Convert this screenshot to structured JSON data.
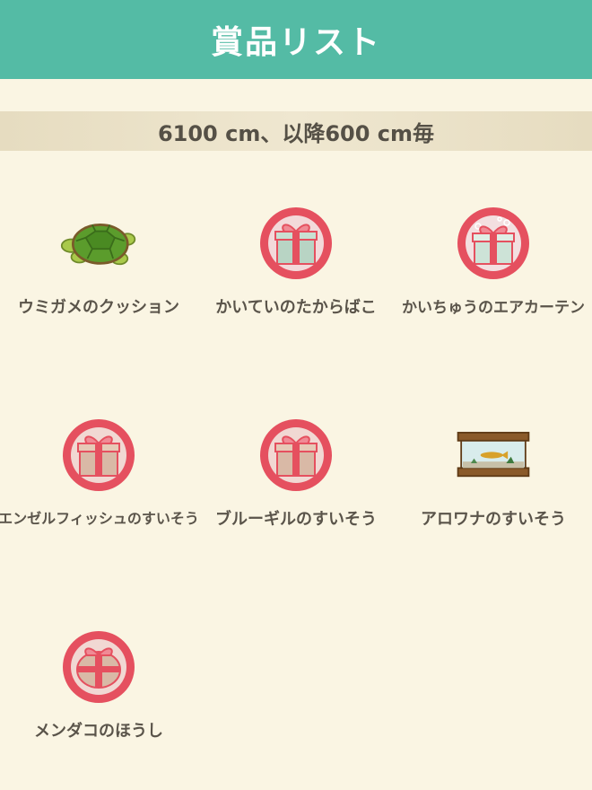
{
  "header": {
    "title": "賞品リスト"
  },
  "band": {
    "text": "6100 cm、以降600 cm毎"
  },
  "prizes": [
    {
      "label": "ウミガメのクッション",
      "icon": "turtle-cushion-icon"
    },
    {
      "label": "かいていのたからばこ",
      "icon": "gift-icon"
    },
    {
      "label": "かいちゅうのエアカーテン",
      "icon": "gift-icon"
    },
    {
      "label": "エンゼルフィッシュのすいそう",
      "icon": "gift-icon"
    },
    {
      "label": "ブルーギルのすいそう",
      "icon": "gift-icon"
    },
    {
      "label": "アロワナのすいそう",
      "icon": "aquarium-icon"
    },
    {
      "label": "メンダコのほうし",
      "icon": "gift-icon"
    }
  ],
  "colors": {
    "header": "#54bba5",
    "background": "#faf5e3",
    "badge": "#e5505f"
  }
}
